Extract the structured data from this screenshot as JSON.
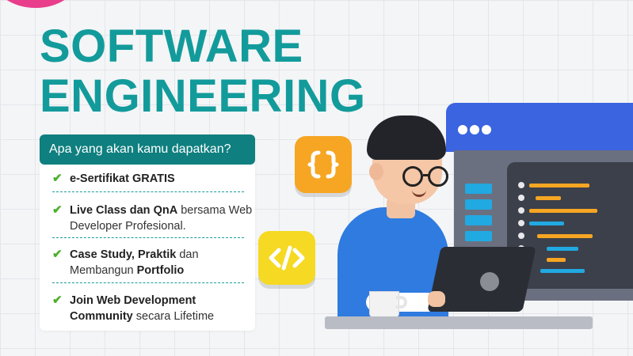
{
  "title": {
    "line1": "SOFTWARE",
    "line2": "ENGINEERING"
  },
  "card": {
    "header": "Apa yang akan kamu dapatkan?",
    "items": [
      {
        "bold": "e-Sertifikat GRATIS",
        "rest": ""
      },
      {
        "bold": "Live Class dan QnA",
        "rest": " bersama Web Developer Profesional."
      },
      {
        "bold": "Case Study, Praktik",
        "rest": " dan Membangun ",
        "bold2": "Portfolio"
      },
      {
        "bold": "Join Web Development Community",
        "rest": " secara Lifetime"
      }
    ]
  },
  "icons": {
    "braces_tile": "{}",
    "code_tile": "</>"
  },
  "colors": {
    "title_teal": "#139b9b",
    "header_teal": "#0f7f7f",
    "check_green": "#4caf2a",
    "braces_tile": "#f6a623",
    "code_tile": "#f5d923",
    "monitor_blue": "#3a64e0",
    "shirt_blue": "#2f7be0"
  }
}
